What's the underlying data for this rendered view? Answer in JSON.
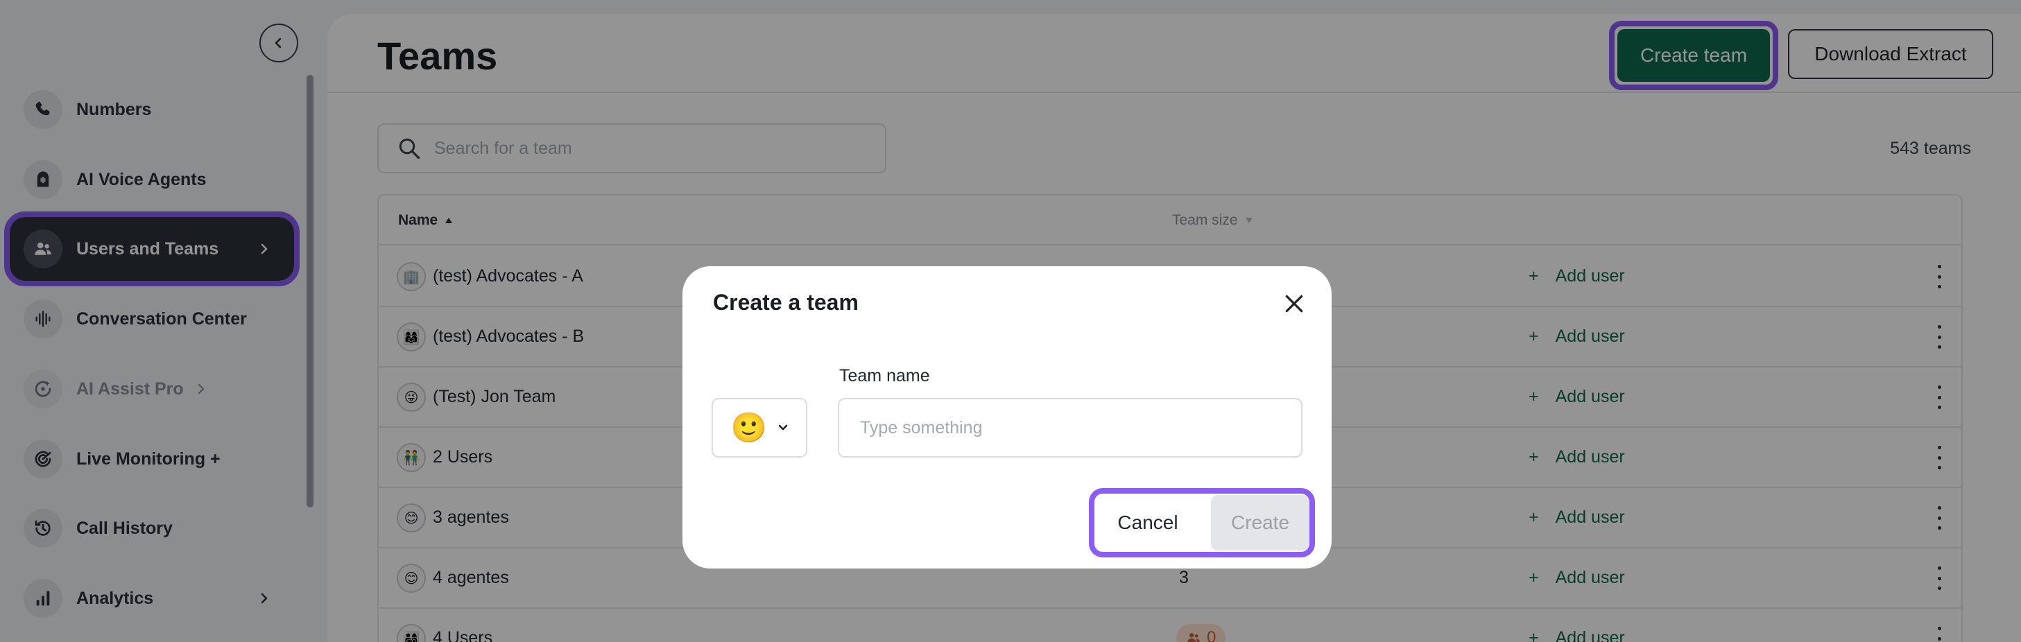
{
  "sidebar": {
    "collapse_icon": "chevron-left-icon",
    "items": [
      {
        "label": "Numbers",
        "icon": "phone-icon"
      },
      {
        "label": "AI Voice Agents",
        "icon": "ai-agent-icon"
      },
      {
        "label": "Users and Teams",
        "icon": "users-icon",
        "active": true
      },
      {
        "label": "Conversation Center",
        "icon": "waveform-icon"
      },
      {
        "label": "AI Assist Pro",
        "icon": "ai-assist-icon",
        "disabled": true
      },
      {
        "label": "Live Monitoring +",
        "icon": "live-monitoring-icon"
      },
      {
        "label": "Call History",
        "icon": "history-icon"
      },
      {
        "label": "Analytics",
        "icon": "bar-chart-icon"
      }
    ]
  },
  "header": {
    "title": "Teams",
    "create_team_label": "Create team",
    "download_label": "Download Extract"
  },
  "search": {
    "placeholder": "Search for a team",
    "count": "543 teams"
  },
  "table": {
    "columns": {
      "name": "Name",
      "team_size": "Team size"
    },
    "add_user_label": "Add user",
    "rows": [
      {
        "name": "(test) Advocates - A",
        "icon": "🏢",
        "size": ""
      },
      {
        "name": "(test) Advocates - B",
        "icon": "👩‍👩‍👧",
        "size": ""
      },
      {
        "name": "(Test) Jon Team",
        "icon": "😜",
        "size": ""
      },
      {
        "name": "2 Users",
        "icon": "👬",
        "size": ""
      },
      {
        "name": "3 agentes",
        "icon": "😊",
        "size": ""
      },
      {
        "name": "4 agentes",
        "icon": "😊",
        "size": "3"
      },
      {
        "name": "4 Users",
        "icon": "👨‍👩‍👧‍👦",
        "size": "0"
      }
    ]
  },
  "modal": {
    "title": "Create a team",
    "emoji": "🙂",
    "field_label": "Team name",
    "input_placeholder": "Type something",
    "input_value": "",
    "cancel_label": "Cancel",
    "create_label": "Create"
  },
  "colors": {
    "accent": "#0f6a4f",
    "highlight": "#8b5cf6",
    "sidebar_active": "#2c333c",
    "badge_bg": "#fde2cf",
    "badge_text": "#c0622b"
  }
}
